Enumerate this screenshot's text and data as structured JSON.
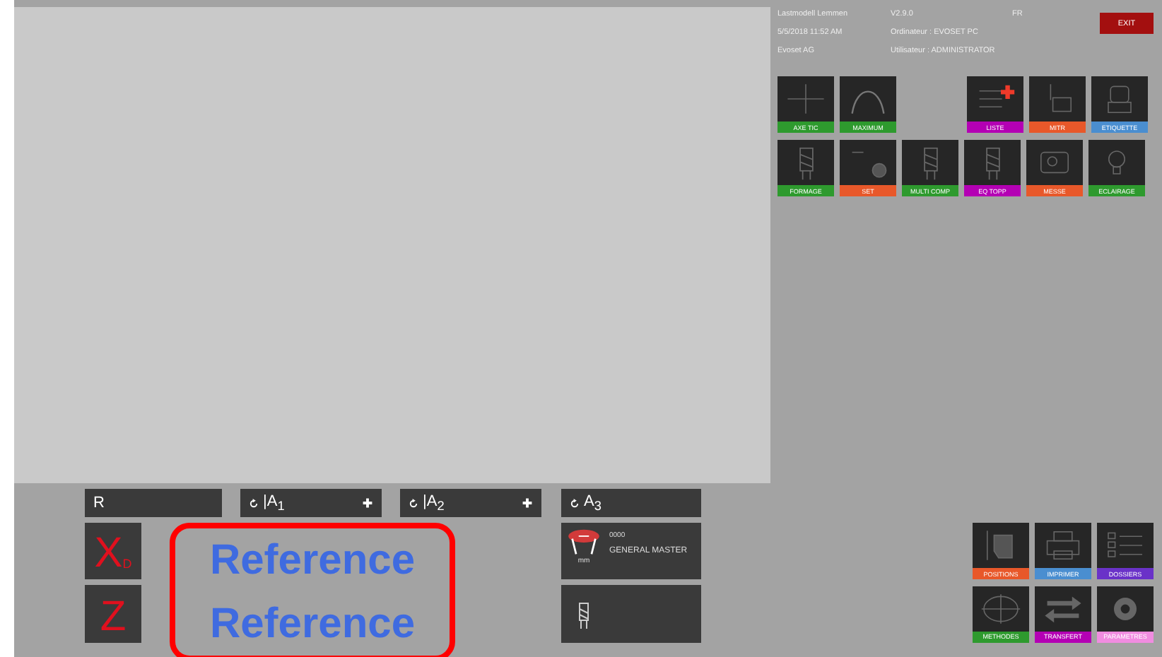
{
  "header": {
    "col1": [
      "Lastmodell Lemmen",
      "5/5/2018 11:52 AM",
      "Evoset AG"
    ],
    "col2": [
      "V2.9.0",
      "Ordinateur : EVOSET PC",
      "Utilisateur : ADMINISTRATOR"
    ],
    "language": "FR",
    "exit": "EXIT"
  },
  "tiles_top_left": [
    {
      "label": "AXE TIC",
      "color": "#2e9a2e"
    },
    {
      "label": "MAXIMUM",
      "color": "#2e9a2e"
    }
  ],
  "tiles_top_right": [
    {
      "label": "LISTE",
      "color": "#b400b4"
    },
    {
      "label": "MITR",
      "color": "#e8582a"
    },
    {
      "label": "ETIQUETTE",
      "color": "#4a8ed0"
    }
  ],
  "tiles_second": [
    {
      "label": "FORMAGE",
      "color": "#2e9a2e"
    },
    {
      "label": "SET",
      "color": "#e8582a"
    },
    {
      "label": "MULTI COMP",
      "color": "#2e9a2e"
    },
    {
      "label": "EQ TOPP",
      "color": "#b400b4"
    },
    {
      "label": "MESSE",
      "color": "#e8582a"
    },
    {
      "label": "ECLAIRAGE",
      "color": "#2e9a2e"
    }
  ],
  "axes": [
    {
      "label": "R"
    },
    {
      "label": "|A$_{1}$",
      "plus": true
    },
    {
      "label": "|A$_{2}$",
      "plus": true
    },
    {
      "label": "A$_{3}$",
      "plus": false
    }
  ],
  "x_axis": {
    "letter": "X",
    "sub": "D"
  },
  "z_axis": {
    "letter": "Z"
  },
  "readings": [
    "Reference",
    "Reference"
  ],
  "tool": {
    "number": "0000",
    "name": "GENERAL MASTER",
    "unit": "mm"
  },
  "tiles_bottom": [
    {
      "label": "POSITIONS",
      "color": "#e8582a"
    },
    {
      "label": "IMPRIMER",
      "color": "#4a8ed0"
    },
    {
      "label": "DOSSIERS",
      "color": "#6a32c8"
    },
    {
      "label": "METHODES",
      "color": "#2e9a2e"
    },
    {
      "label": "TRANSFERT",
      "color": "#b400b4"
    },
    {
      "label": "PARAMETRES",
      "color": "#f08ce0"
    }
  ]
}
